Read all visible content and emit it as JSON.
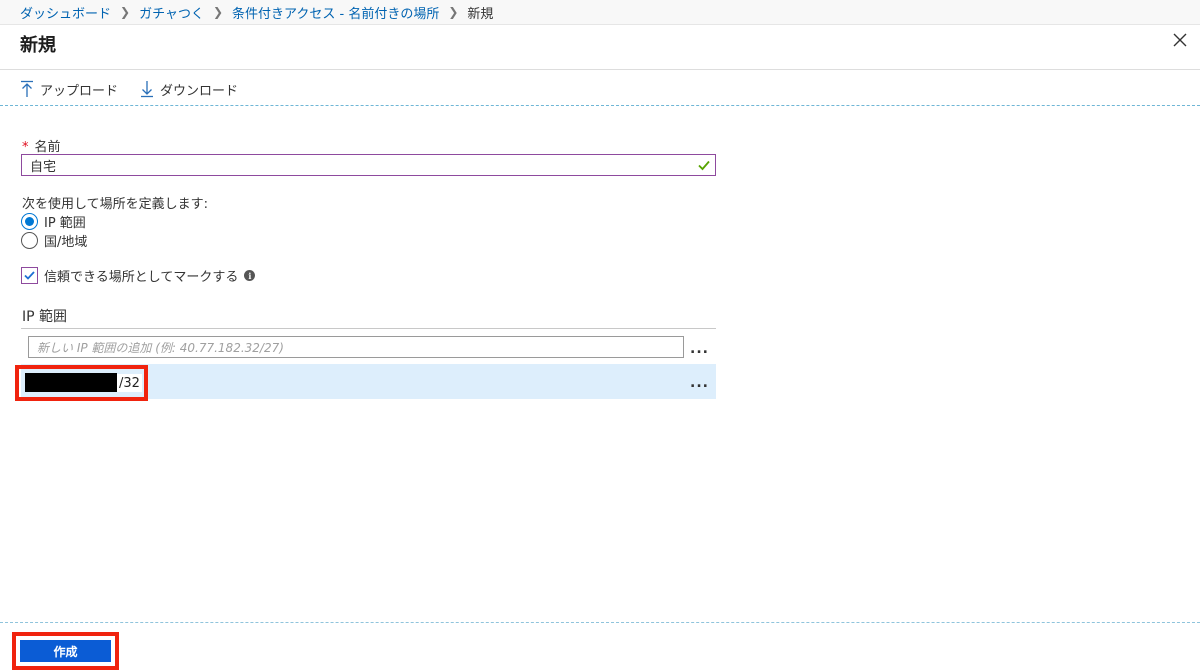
{
  "breadcrumb": {
    "items": [
      "ダッシュボード",
      "ガチャつく",
      "条件付きアクセス - 名前付きの場所",
      "新規"
    ]
  },
  "title": "新規",
  "toolbar": {
    "upload_label": "アップロード",
    "download_label": "ダウンロード"
  },
  "form": {
    "name_label": "名前",
    "required_marker": "*",
    "name_value": "自宅",
    "define_label": "次を使用して場所を定義します:",
    "radio_ip_label": "IP 範囲",
    "radio_country_label": "国/地域",
    "radio_selected": "IP 範囲",
    "trusted_label": "信頼できる場所としてマークする",
    "trusted_checked": true,
    "ip_section_title": "IP 範囲",
    "ip_placeholder": "新しい IP 範囲の追加 (例: 40.77.182.32/27)",
    "ip_entries": [
      {
        "value_visible": "/32"
      }
    ],
    "more_label": "..."
  },
  "footer": {
    "create_label": "作成"
  },
  "colors": {
    "link": "#0063b1",
    "primary_button": "#0b5cd5",
    "selected_row": "#ddeefc",
    "highlight_box": "#f0230e",
    "input_focus": "#8e4a9e",
    "valid_check": "#57a300"
  },
  "icons": [
    "upload-icon",
    "download-icon",
    "close-icon",
    "checkmark-icon",
    "info-icon",
    "chevron-right-icon"
  ]
}
